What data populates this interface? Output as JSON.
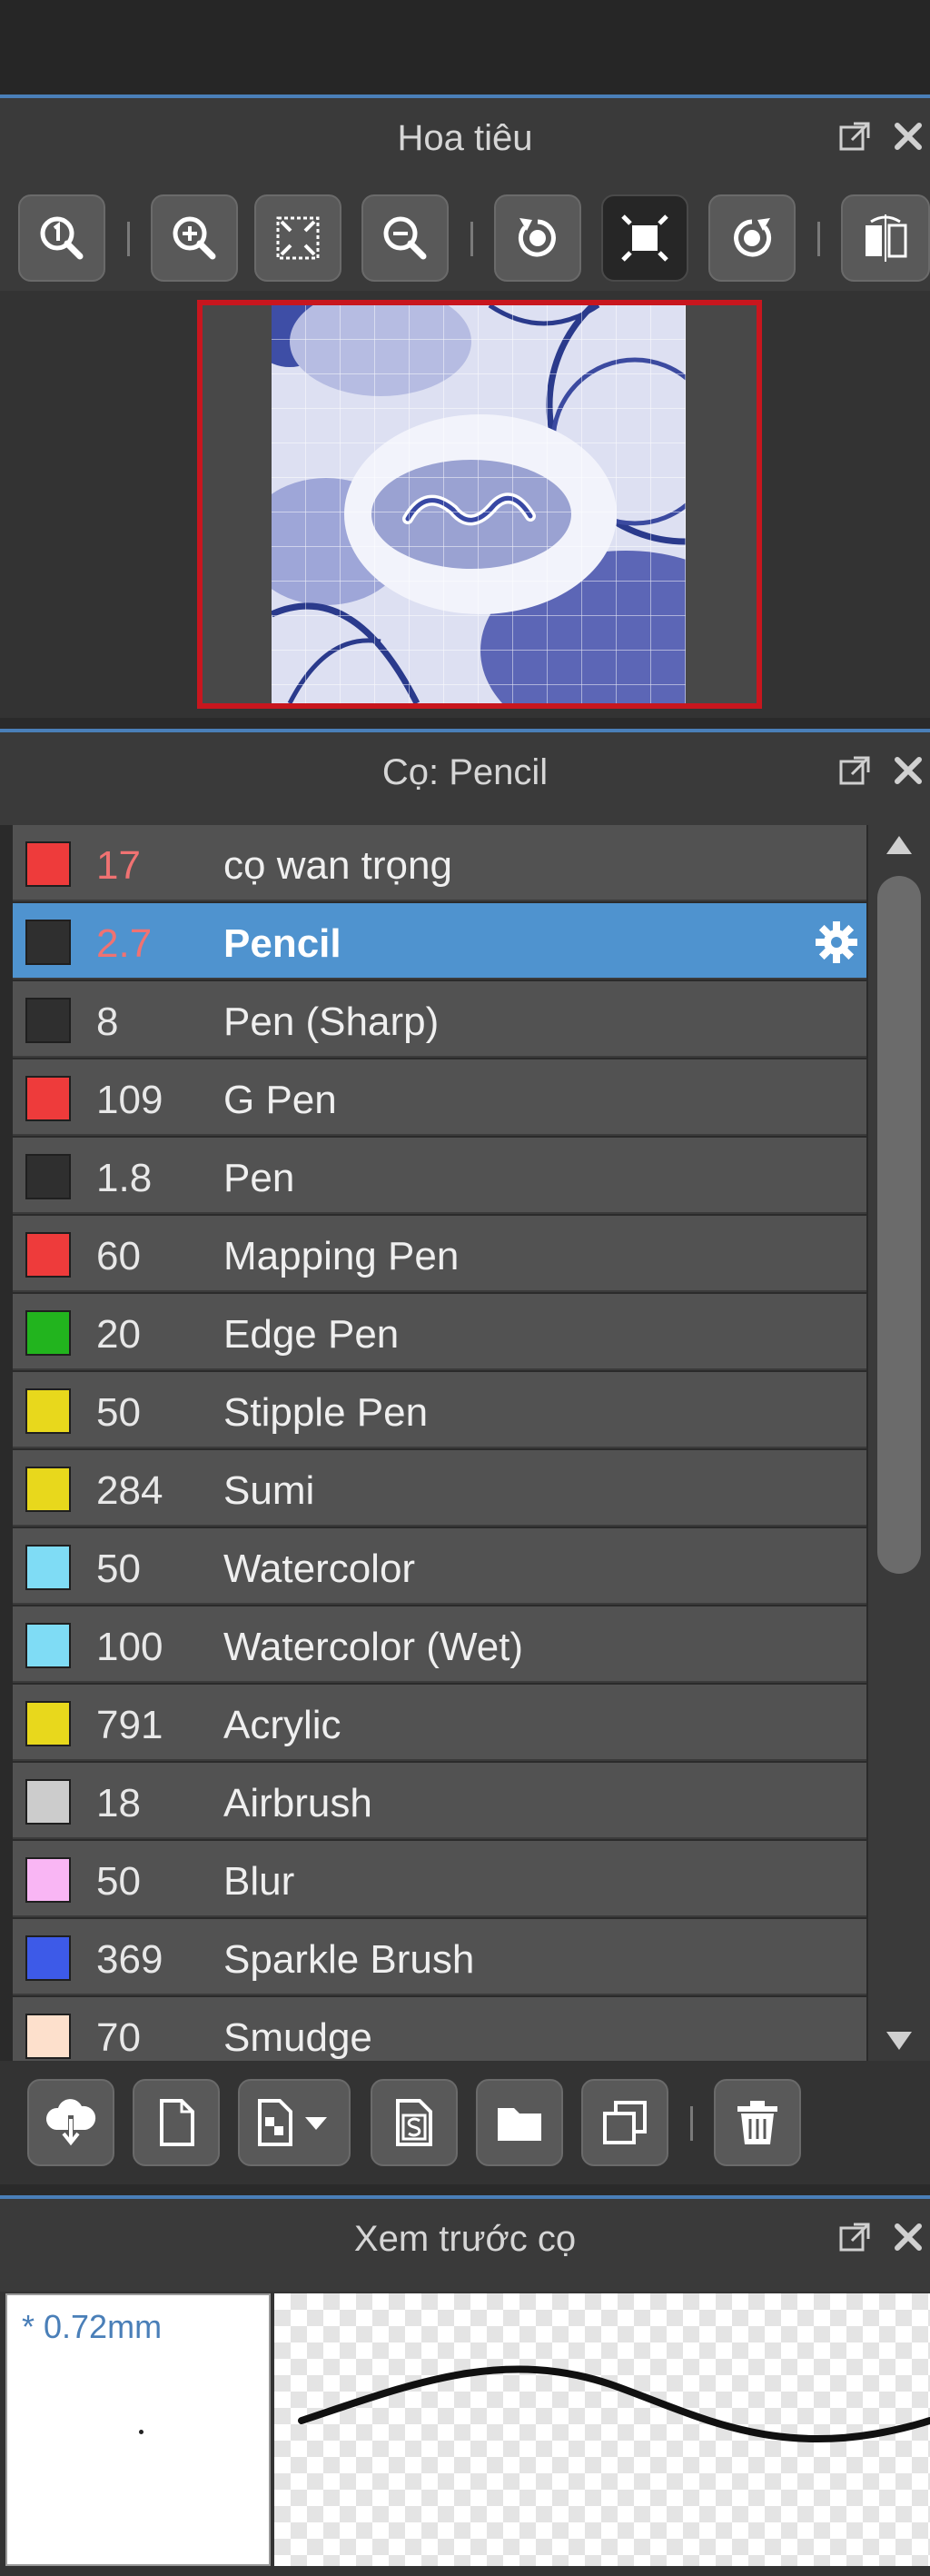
{
  "navigator": {
    "title": "Hoa tiêu",
    "tools": [
      "actual-size",
      "zoom-in",
      "fit-to-window",
      "zoom-out",
      "rotate-left",
      "fit-canvas",
      "rotate-right",
      "flip-horizontal"
    ]
  },
  "brush_panel": {
    "title": "Cọ: Pencil",
    "items": [
      {
        "size": "17",
        "name": "cọ wan trọng",
        "color": "#ee3b3b"
      },
      {
        "size": "2.7",
        "name": "Pencil",
        "color": "#2f2f2f",
        "selected": true
      },
      {
        "size": "8",
        "name": "Pen (Sharp)",
        "color": "#2f2f2f"
      },
      {
        "size": "109",
        "name": "G Pen",
        "color": "#ee3b3b"
      },
      {
        "size": "1.8",
        "name": "Pen",
        "color": "#2f2f2f"
      },
      {
        "size": "60",
        "name": "Mapping Pen",
        "color": "#ee3b3b"
      },
      {
        "size": "20",
        "name": "Edge Pen",
        "color": "#22b41e"
      },
      {
        "size": "50",
        "name": "Stipple Pen",
        "color": "#e8d81c"
      },
      {
        "size": "284",
        "name": "Sumi",
        "color": "#e8d81c"
      },
      {
        "size": "50",
        "name": "Watercolor",
        "color": "#7fdcf5"
      },
      {
        "size": "100",
        "name": "Watercolor (Wet)",
        "color": "#7fdcf5"
      },
      {
        "size": "791",
        "name": "Acrylic",
        "color": "#e8d81c"
      },
      {
        "size": "18",
        "name": "Airbrush",
        "color": "#cccccc"
      },
      {
        "size": "50",
        "name": "Blur",
        "color": "#f9b6f4"
      },
      {
        "size": "369",
        "name": "Sparkle Brush",
        "color": "#3d5ae8"
      },
      {
        "size": "70",
        "name": "Smudge",
        "color": "#fde0cc"
      }
    ],
    "tools": [
      "import-brush",
      "new-brush",
      "brush-type-dropdown",
      "script-brush",
      "open-folder",
      "duplicate-brush",
      "delete-brush"
    ]
  },
  "brush_preview": {
    "title": "Xem trước cọ",
    "size_label": "* 0.72mm"
  },
  "colors": {
    "accent": "#4a7fb8",
    "selected_row": "#4f93cf",
    "navigator_frame": "#c8161e"
  }
}
